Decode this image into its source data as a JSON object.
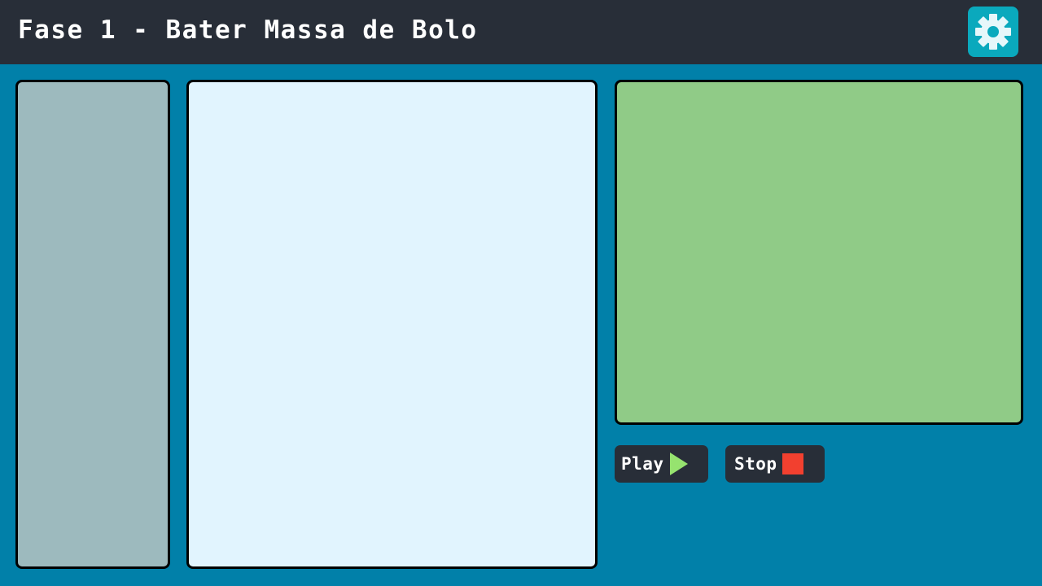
{
  "header": {
    "title": "Fase 1 - Bater Massa de Bolo",
    "settings_icon": "gear-icon"
  },
  "controls": {
    "play_label": "Play",
    "play_icon": "play-triangle-icon",
    "stop_label": "Stop",
    "stop_icon": "stop-square-icon"
  },
  "colors": {
    "topbar": "#282e38",
    "background": "#0180a9",
    "settings_button": "#0aa9bd",
    "blocks_panel": "#9dbabe",
    "workspace_panel": "#e1f4fe",
    "stage_panel": "#90cb87",
    "play_icon": "#96e36f",
    "stop_icon": "#f2402f"
  }
}
